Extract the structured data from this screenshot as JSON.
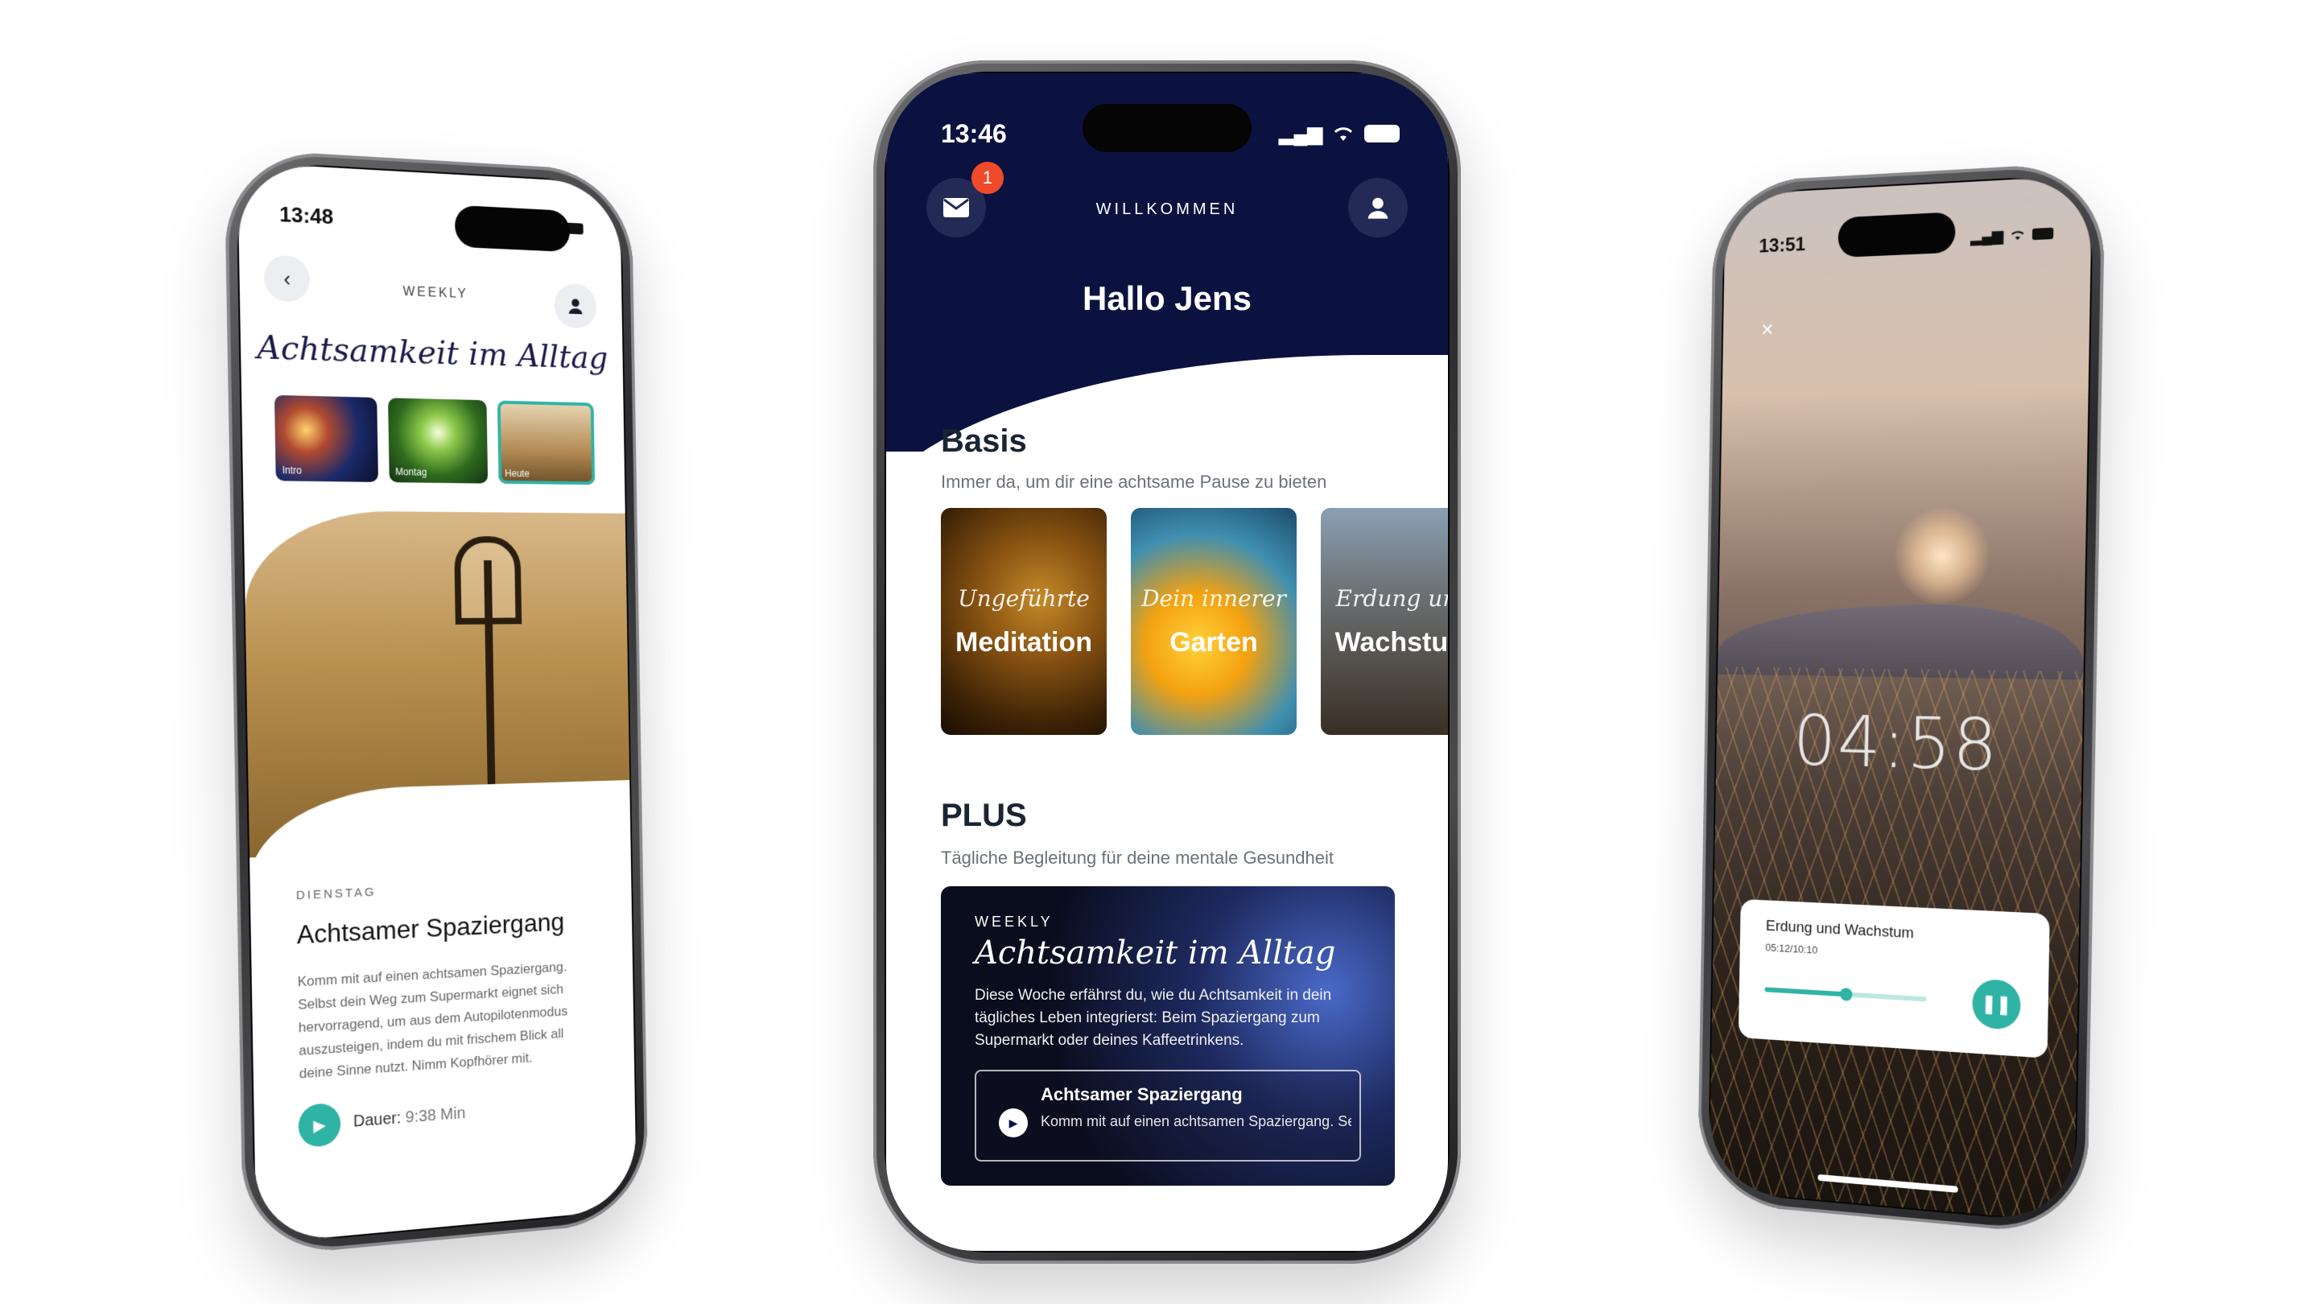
{
  "left_phone": {
    "status_time": "13:48",
    "header_label": "WEEKLY",
    "script_title": "Achtsamkeit im Alltag",
    "thumbnails": [
      {
        "label": "Intro"
      },
      {
        "label": "Montag"
      },
      {
        "label": "Heute"
      }
    ],
    "day_label": "DIENSTAG",
    "title": "Achtsamer Spaziergang",
    "description": "Komm mit auf einen achtsamen Spaziergang. Selbst dein Weg zum Supermarkt eignet sich hervorragend, um aus dem Autopilotenmodus auszusteigen, indem du mit frischem Blick all deine Sinne nutzt. Nimm Kopfhörer mit.",
    "duration_label": "Dauer:",
    "duration_value": "9:38 Min"
  },
  "center_phone": {
    "status_time": "13:46",
    "header_label": "WILLKOMMEN",
    "greeting": "Hallo Jens",
    "mail_badge_count": "1",
    "basis": {
      "title": "Basis",
      "subtitle": "Immer da, um dir eine achtsame Pause zu bieten",
      "cards": [
        {
          "script": "Ungeführte",
          "title": "Meditation"
        },
        {
          "script": "Dein innerer",
          "title": "Garten"
        },
        {
          "script": "Erdung und",
          "title": "Wachstum"
        }
      ]
    },
    "plus": {
      "title": "PLUS",
      "subtitle": "Tägliche Begleitung für deine mentale Gesundheit",
      "weekly_card": {
        "label": "WEEKLY",
        "script_title": "Achtsamkeit im Alltag",
        "description": "Diese Woche erfährst du, wie du Achtsamkeit in dein tägliches Leben integrierst: Beim Spaziergang zum Supermarkt oder deines Kaffeetrinkens.",
        "episode_title": "Achtsamer Spaziergang",
        "episode_text": "Komm mit auf einen achtsamen Spaziergang. Selbst dein Weg zum Supermarkt eignet sich"
      }
    }
  },
  "right_phone": {
    "status_time": "13:51",
    "timer": "04:58",
    "player": {
      "title": "Erdung und Wachstum",
      "time": "05:12/10:10",
      "progress": 0.51
    }
  },
  "colors": {
    "navy": "#0c1240",
    "teal": "#2fb3a5",
    "badge_red": "#f04a2a"
  }
}
